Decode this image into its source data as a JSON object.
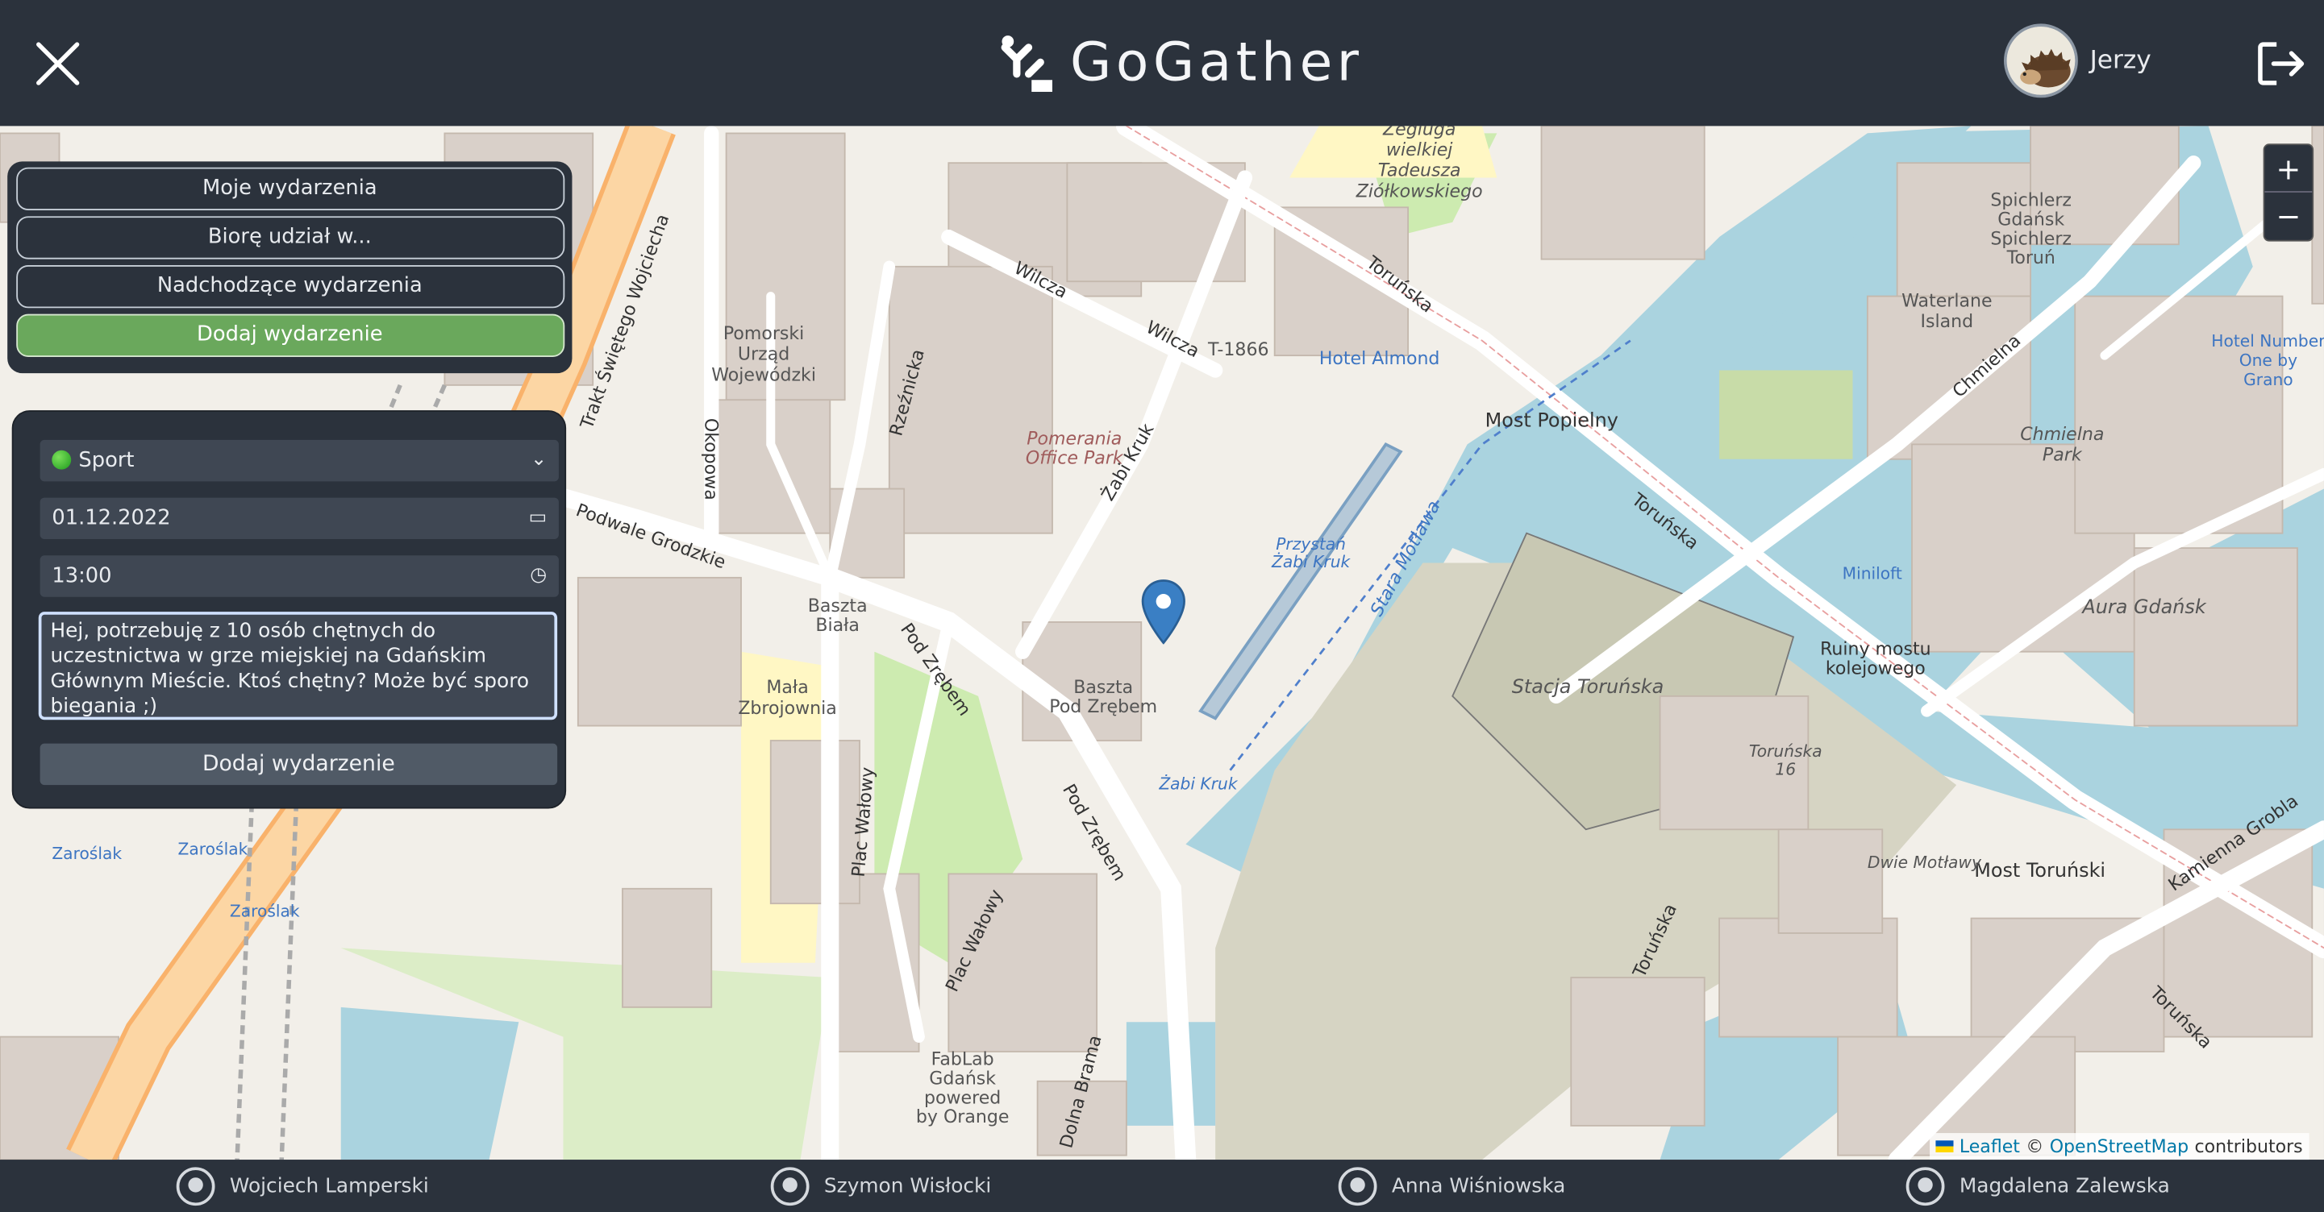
{
  "header": {
    "logo_text": "GoGather",
    "user_name": "Jerzy"
  },
  "menu": {
    "items": [
      {
        "label": "Moje wydarzenia"
      },
      {
        "label": "Biorę udział w..."
      },
      {
        "label": "Nadchodzące wydarzenia"
      },
      {
        "label": "Dodaj wydarzenie"
      }
    ]
  },
  "form": {
    "category": "Sport",
    "date": "01.12.2022",
    "time": "13:00",
    "description": "Hej, potrzebuję z 10 osób chętnych do uczestnictwa w grze miejskiej na Gdańskim Głównym Mieście. Ktoś chętny? Może być sporo biegania ;)",
    "submit_label": "Dodaj wydarzenie"
  },
  "map": {
    "zoom_in": "+",
    "zoom_out": "−",
    "labels": {
      "most_popielny": "Most Popielny",
      "most_torunski": "Most Toruński",
      "stacja": "Stacja Toruńska",
      "baszta_biala": "Baszta\nBiała",
      "baszta_zrebem": "Baszta\nPod Zrębem",
      "hotel": "Hotel Almond",
      "pomerania": "Pomerania\nOffice Park",
      "mala_zbrojownia": "Mała\nZbrojownia",
      "pomorski": "Pomorski\nUrząd\nWojewódzki",
      "przystan": "Przystań\nŻabi Kruk",
      "stara_motlawa": "Stara Motława",
      "zabi_kruk": "Żabi Kruk",
      "ruiny": "Ruiny mostu\nkolejowego",
      "aura": "Aura Gdańsk",
      "chmielna_park": "Chmielna\nPark",
      "minilioft": "Miniloft",
      "waterlane": "Waterlane\nIsland",
      "spichlerz": "Spichlerz\nGdańsk\nSpichlerz\nToruń",
      "fablab": "FabLab\nGdańsk\npowered\nby Orange",
      "dwie_motlawy": "Dwie Motławy",
      "torunska16": "Toruńska\n16",
      "ziolkowski": "Zegluga\nwielkiej\nTadeusza\nZiółkowskiego",
      "t1866": "T-1866",
      "hotel_number": "Hotel Number\nOne by\nGrano"
    },
    "streets": {
      "torunska": "Toruńska",
      "wilcza": "Wilcza",
      "zabi_kruk": "Żabi Kruk",
      "rzeznicka": "Rzeźnicka",
      "okopowa": "Okopowa",
      "podwale": "Podwale Grodzkie",
      "pod_zrebem": "Pod Zrębem",
      "plac_walowy": "Plac Wałowy",
      "chmielna": "Chmielna",
      "kamienna_grobla": "Kamienna Grobla",
      "dolna_brama": "Dolna Brama",
      "trakt": "Trakt Świętego Wojciecha",
      "zaroslak": "Zaroślak"
    },
    "attribution": {
      "leaflet": "Leaflet",
      "copyright": "©",
      "osm": "OpenStreetMap",
      "contributors": "contributors"
    }
  },
  "footer": {
    "authors": [
      "Wojciech Lamperski",
      "Szymon Wisłocki",
      "Anna Wiśniowska",
      "Magdalena Zalewska"
    ]
  },
  "colors": {
    "panel": "#2b323c",
    "accent_green": "#6aa85c",
    "water": "#aad3df",
    "land": "#f2efe9"
  }
}
